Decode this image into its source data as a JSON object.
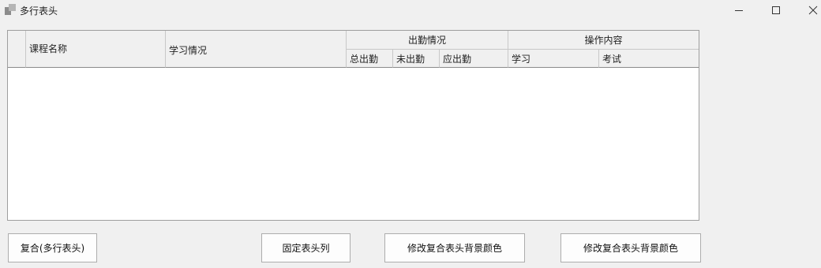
{
  "window": {
    "title": "多行表头"
  },
  "grid": {
    "columns": {
      "course_name": "课程名称",
      "study_status": "学习情况",
      "attendance_group": "出勤情况",
      "total_attendance": "总出勤",
      "absent": "未出勤",
      "expected_attendance": "应出勤",
      "operation_group": "操作内容",
      "study": "学习",
      "exam": "考试"
    }
  },
  "buttons": {
    "composite": "复合(多行表头)",
    "freeze_header_columns": "固定表头列",
    "change_bg_color_1": "修改复合表头背景颜色",
    "change_bg_color_2": "修改复合表头背景颜色"
  }
}
